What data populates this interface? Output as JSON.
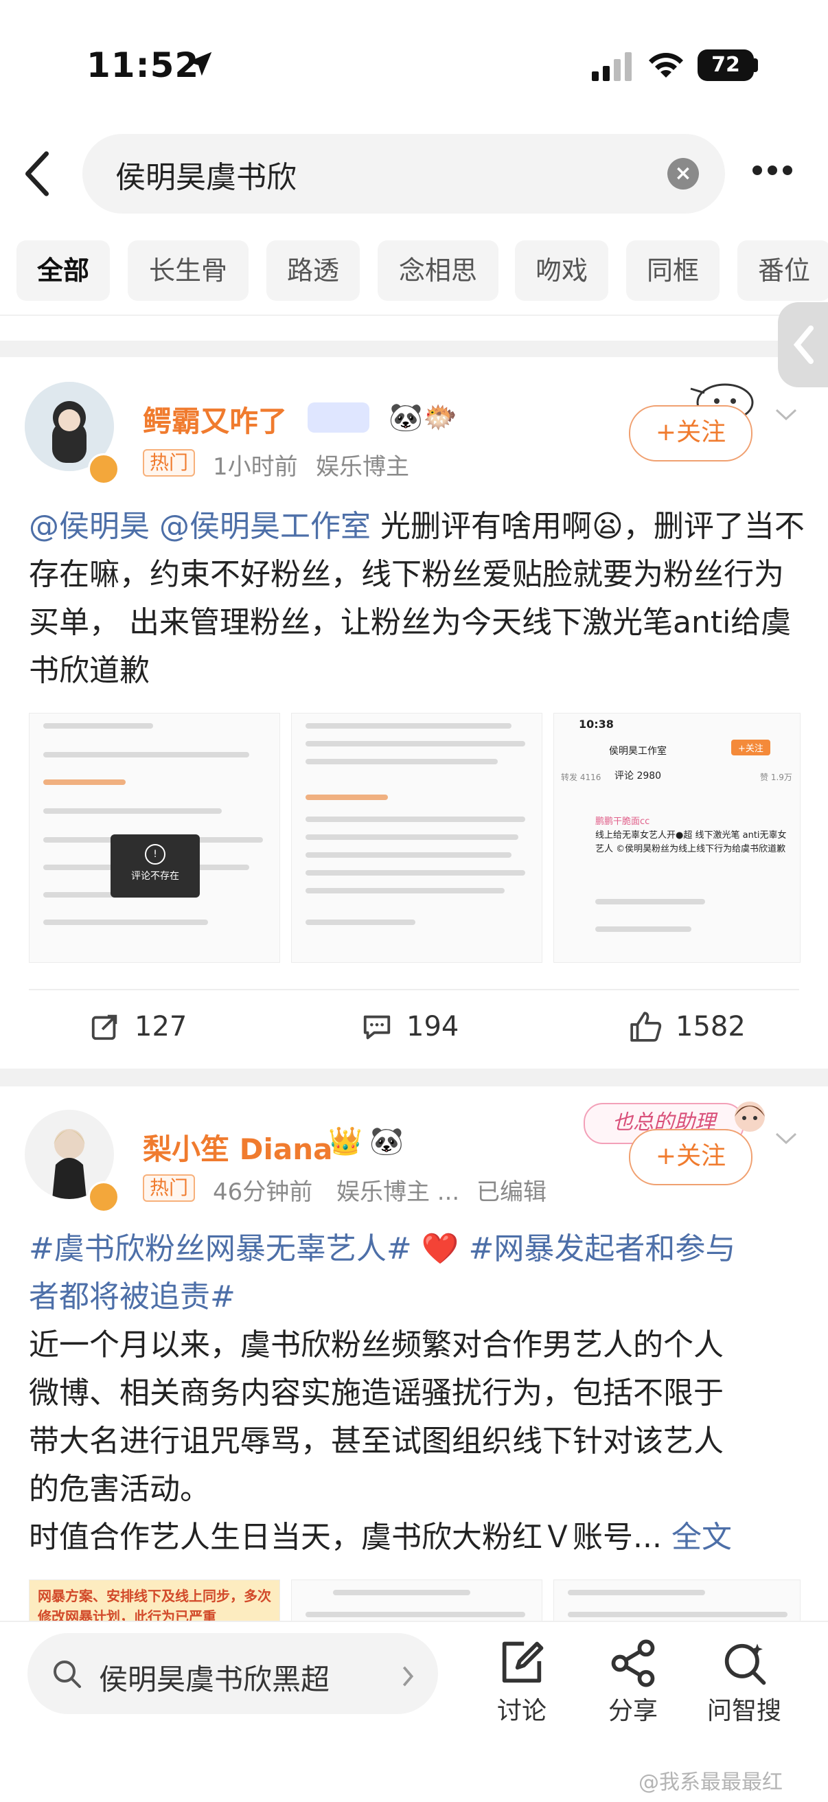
{
  "status": {
    "time": "11:52",
    "battery": "72"
  },
  "search": {
    "query": "侯明昊虞书欣"
  },
  "tabs": [
    "全部",
    "长生骨",
    "路透",
    "念相思",
    "吻戏",
    "同框",
    "番位"
  ],
  "posts": [
    {
      "username": "鳄霸又咋了",
      "badge": "热门",
      "time": "1小时前",
      "source": "娱乐博主",
      "follow": "+关注",
      "mention1": "@侯明昊",
      "mention2": "@侯明昊工作室",
      "text": "光删评有啥用啊😦，删评了当不存在嘛，约束不好粉丝，线下粉丝爱贴脸就要为粉丝行为买单， 出来管理粉丝，让粉丝为今天线下激光笔anti给虞书欣道歉",
      "image_overlay": "评论不存在",
      "thumb3": {
        "time": "10:38",
        "account": "侯明昊工作室",
        "follow": "+关注",
        "repost": "转发 4116",
        "comments": "评论 2980",
        "likes": "赞 1.9万",
        "caption": "鹏鹏干脆面cc",
        "comment": "线上给无辜女艺人开●超 线下激光笔 anti无辜女艺人 ©侯明昊粉丝为线上线下行为给虞书欣道歉"
      },
      "actions": {
        "repost": "127",
        "comment": "194",
        "like": "1582"
      }
    },
    {
      "username": "梨小笙 Diana",
      "badge": "热门",
      "time": "46分钟前",
      "source": "娱乐博主 ...",
      "edited": "已编辑",
      "follow": "+关注",
      "sticker": "也总的助理",
      "tag1": "#虞书欣粉丝网暴无辜艺人#",
      "tag2a": "#网暴发起者和参与",
      "tag2b": "者都将被追责#",
      "para1a": "近一个月以来，虞书欣粉丝频繁对合作男艺人的个人",
      "para1b": "微博、相关商务内容实施造谣骚扰行为，包括不限于",
      "para1c": "带大名进行诅咒辱骂，甚至试图组织线下针对该艺人",
      "para1d": "的危害活动。",
      "para2": "时值合作艺人生日当天，虞书欣大粉红Ｖ账号...",
      "full_text": "全文",
      "img1_text": "网暴方案、安排线下及线上同步，多次修改网暴计划，此行为已严重"
    }
  ],
  "bottom": {
    "search_text": "侯明昊虞书欣黑超",
    "discuss": "讨论",
    "share": "分享",
    "ask": "问智搜"
  },
  "watermark": "@我系最最最红"
}
